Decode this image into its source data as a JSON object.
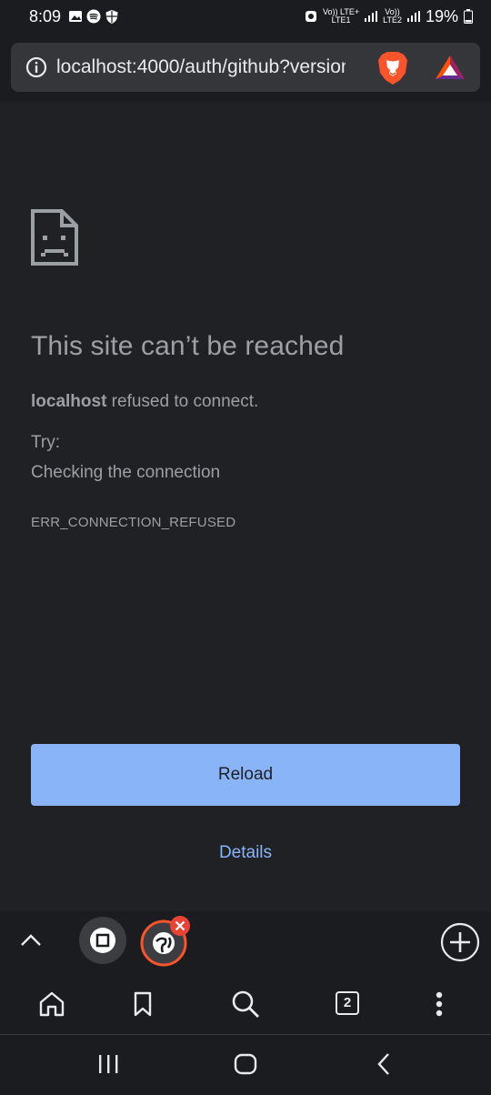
{
  "status": {
    "time": "8:09",
    "net1": "Vo)) LTE+",
    "net1_sub": "LTE1",
    "net2": "Vo))",
    "net2_sub": "LTE2",
    "battery": "19%"
  },
  "browser": {
    "url": "localhost:4000/auth/github?version",
    "tab_count": "2"
  },
  "error_page": {
    "heading": "This site can’t be reached",
    "host": "localhost",
    "message": " refused to connect.",
    "try_label": "Try:",
    "suggestion": "Checking the connection",
    "error_code": "ERR_CONNECTION_REFUSED",
    "reload_label": "Reload",
    "details_label": "Details"
  },
  "icons": {
    "info": "info-icon",
    "brave": "brave-lion-icon",
    "bat": "bat-rewards-icon",
    "home": "home-icon",
    "bookmark": "bookmark-icon",
    "search": "search-icon",
    "menu": "more-vert-icon"
  },
  "colors": {
    "background": "#202124",
    "accent": "#8ab4f8",
    "text": "#9aa0a6",
    "brave_orange": "#fb542b"
  }
}
